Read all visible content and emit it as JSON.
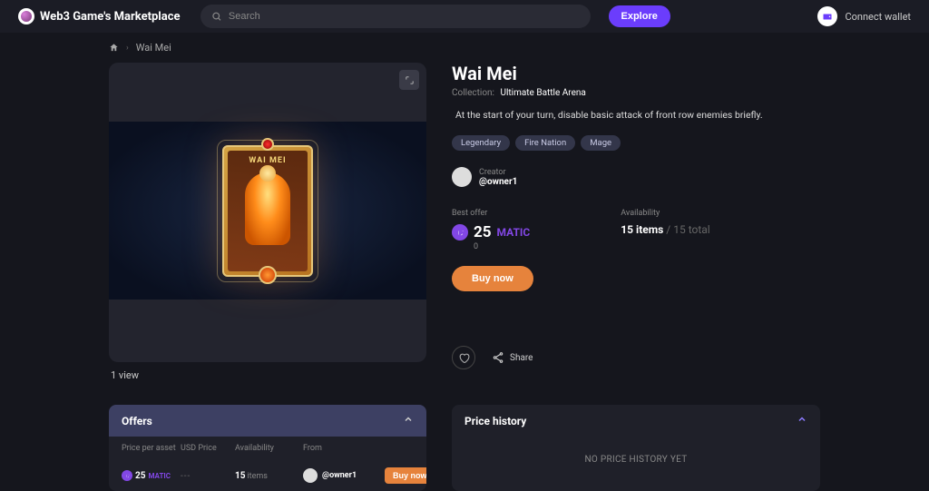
{
  "header": {
    "brand": "Web3 Game's Marketplace",
    "search_placeholder": "Search",
    "explore": "Explore",
    "connect": "Connect wallet"
  },
  "breadcrumb": {
    "current": "Wai Mei"
  },
  "item": {
    "title": "Wai Mei",
    "card_art_title": "WAI MEI",
    "collection_label": "Collection:",
    "collection_name": "Ultimate Battle Arena",
    "description": "At the start of your turn, disable basic attack of front row enemies briefly.",
    "tags": [
      "Legendary",
      "Fire Nation",
      "Mage"
    ],
    "creator_label": "Creator",
    "creator_handle": "@owner1",
    "view_count": "1 view",
    "best_offer_label": "Best offer",
    "best_offer_value": "25",
    "best_offer_currency": "MATIC",
    "best_offer_usd": "0",
    "availability_label": "Availability",
    "availability_items": "15 items",
    "availability_total": " / 15 total",
    "buy_now": "Buy now",
    "share": "Share"
  },
  "offers": {
    "title": "Offers",
    "columns": {
      "price": "Price per asset",
      "usd": "USD Price",
      "avail": "Availability",
      "from": "From"
    },
    "row": {
      "price_value": "25",
      "price_currency": "MATIC",
      "usd_value": "---",
      "avail_count": "15",
      "avail_label": "items",
      "from_handle": "@owner1",
      "buy": "Buy now"
    }
  },
  "price_history": {
    "title": "Price history",
    "empty": "NO PRICE HISTORY YET"
  }
}
